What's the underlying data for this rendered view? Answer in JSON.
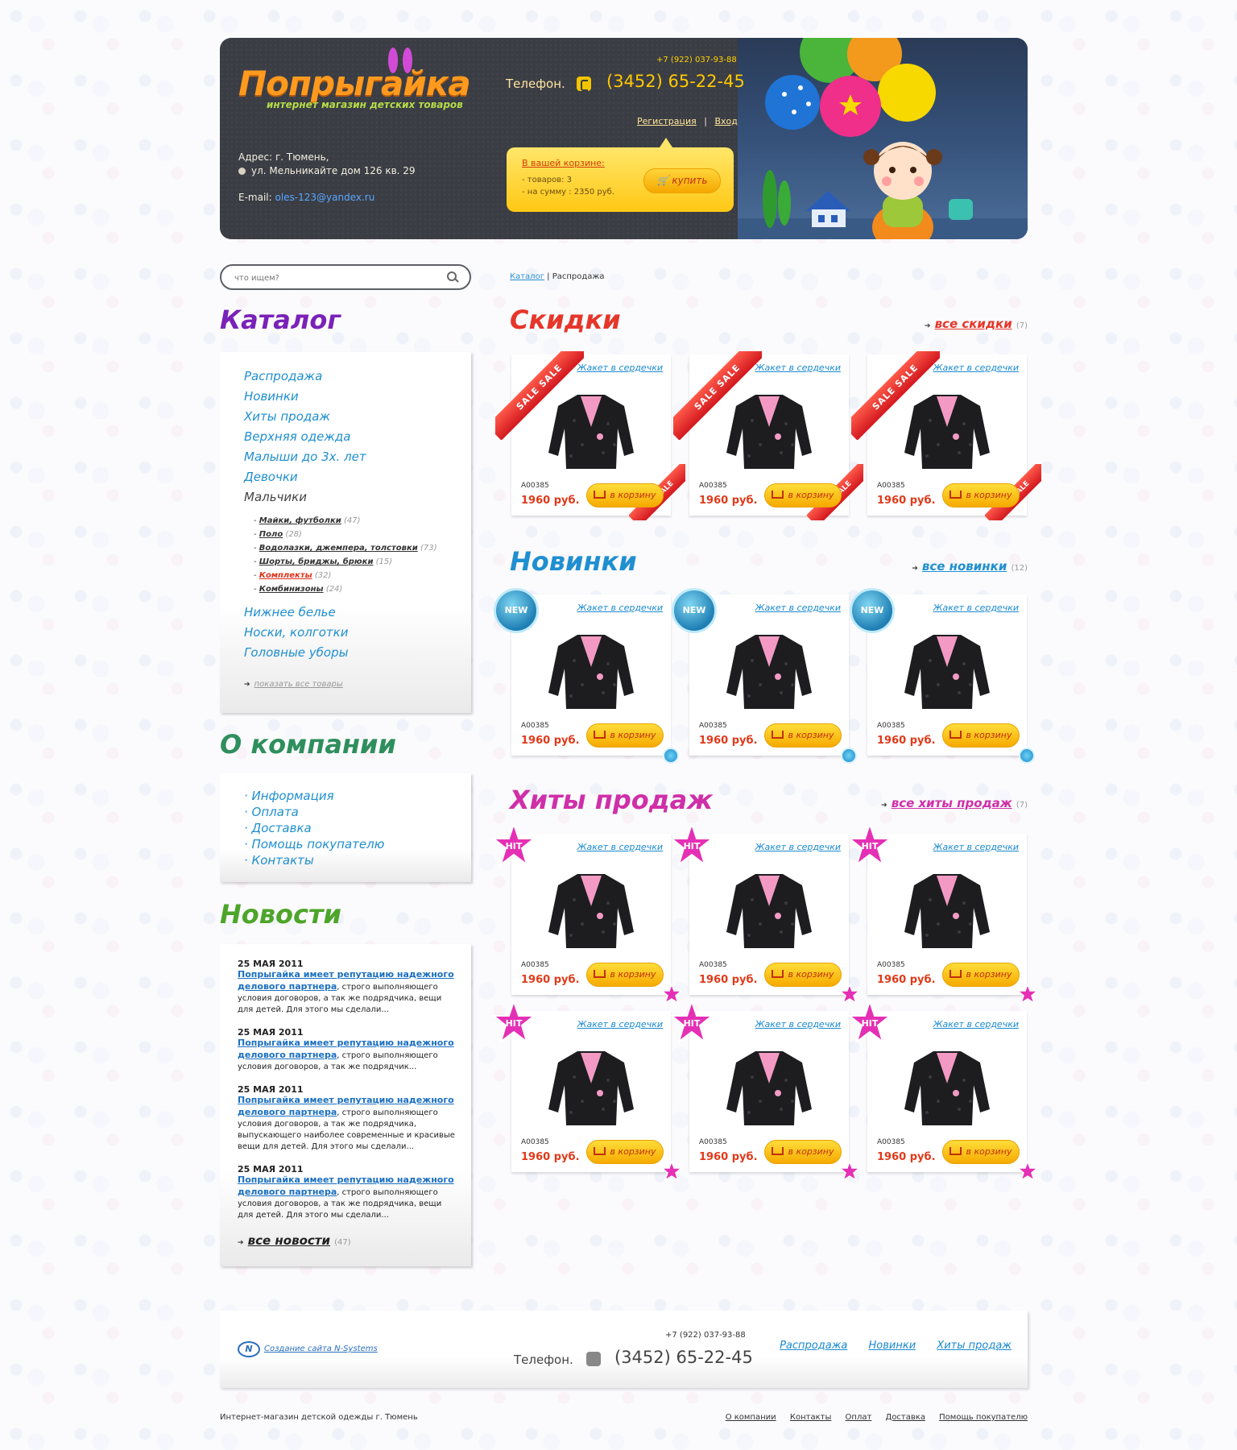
{
  "header": {
    "logo": "Попрыгайка",
    "tagline": "интернет магазин детских товаров",
    "address_line1": "Адрес: г. Тюмень,",
    "address_line2": "ул. Мельникайте дом 126 кв. 29",
    "email_label": "E-mail:",
    "email": "oles-123@yandex.ru",
    "phone_small": "+7 (922) 037-93-88",
    "phone_label": "Телефон.",
    "phone_main": "(3452) 65-22-45",
    "register": "Регистрация",
    "separator": "|",
    "login": "Вход",
    "cart": {
      "title": "В вашей корзине:",
      "items": "- товаров: 3",
      "sum": "- на сумму : 2350 руб.",
      "buy": "купить"
    }
  },
  "search": {
    "placeholder": "что ищем?"
  },
  "breadcrumb": {
    "root": "Каталог",
    "separator": "|",
    "current": "Распродажа"
  },
  "sidebar": {
    "catalog_title": "Каталог",
    "catalog_items": [
      "Распродажа",
      "Новинки",
      "Хиты продаж",
      "Верхняя одежда",
      "Малыши до 3х. лет",
      "Девочки",
      "Мальчики"
    ],
    "sub_items": [
      {
        "label": "Майки, футболки",
        "count": "(47)"
      },
      {
        "label": "Поло",
        "count": "(28)"
      },
      {
        "label": "Водолазки, джемпера, толстовки",
        "count": "(73)"
      },
      {
        "label": "Шорты, бриджы, брюки",
        "count": "(15)"
      },
      {
        "label": "Комплекты",
        "count": "(32)"
      },
      {
        "label": "Комбинизоны",
        "count": "(24)"
      }
    ],
    "catalog_items_after": [
      "Нижнее белье",
      "Носки, колготки",
      "Головные уборы"
    ],
    "show_all": "показать все товары",
    "company_title": "О компании",
    "company_items": [
      "Информация",
      "Оплата",
      "Доставка",
      "Помощь покупателю",
      "Контакты"
    ],
    "news_title": "Новости",
    "news": [
      {
        "date": "25 МАЯ 2011",
        "title": "Попрыгайка имеет репутацию надежного делового партнера",
        "body": ", строго выполняющего условия договоров, а так же подрядчика, вещи для детей. Для этого мы сделали..."
      },
      {
        "date": "25 МАЯ 2011",
        "title": "Попрыгайка имеет репутацию надежного делового партнера",
        "body": ", строго выполняющего условия договоров, а так же подрядчик..."
      },
      {
        "date": "25 МАЯ 2011",
        "title": "Попрыгайка имеет репутацию надежного делового партнера",
        "body": ", строго выполняющего условия договоров, а так же подрядчика, выпускающего наиболее современные и красивые вещи для детей. Для этого мы сделали..."
      },
      {
        "date": "25 МАЯ 2011",
        "title": "Попрыгайка имеет репутацию надежного делового партнера",
        "body": ", строго выполняющего условия договоров, а так же подрядчика, вещи для детей. Для этого мы сделали..."
      }
    ],
    "all_news": "все новости",
    "all_news_count": "(47)"
  },
  "sections": {
    "sale": {
      "title": "Скидки",
      "all": "все скидки",
      "count": "(7)",
      "badge": "SALE SALE",
      "badge_small": "SALE"
    },
    "new": {
      "title": "Новинки",
      "all": "все новинки",
      "count": "(12)",
      "badge": "NEW"
    },
    "hits": {
      "title": "Хиты продаж",
      "all": "все хиты продаж",
      "count": "(7)",
      "badge": "HIT"
    }
  },
  "product": {
    "name": "Жакет в сердечки",
    "sku": "A00385",
    "price": "1960 руб.",
    "to_cart": "в корзину"
  },
  "footer": {
    "credit": "Создание сайта N-Systems",
    "credit_logo": "N",
    "phone_small": "+7 (922) 037-93-88",
    "phone_label": "Телефон.",
    "phone_main": "(3452) 65-22-45",
    "nav": [
      "Распродажа",
      "Новинки",
      "Хиты продаж"
    ],
    "copyright": "Интернет-магазин детской одежды г. Тюмень",
    "bottom_links": [
      "О компании",
      "Контакты",
      "Оплат",
      "Доставка",
      "Помощь покупателю"
    ]
  },
  "colors": {
    "catalog_title": "#7a22b8",
    "company_title": "#2e8f5c",
    "news_title": "#4da52a",
    "sale_title": "#e6362a",
    "new_title": "#1f8fd0",
    "hits_title": "#cf2fa8",
    "link": "#1f8fd0"
  }
}
